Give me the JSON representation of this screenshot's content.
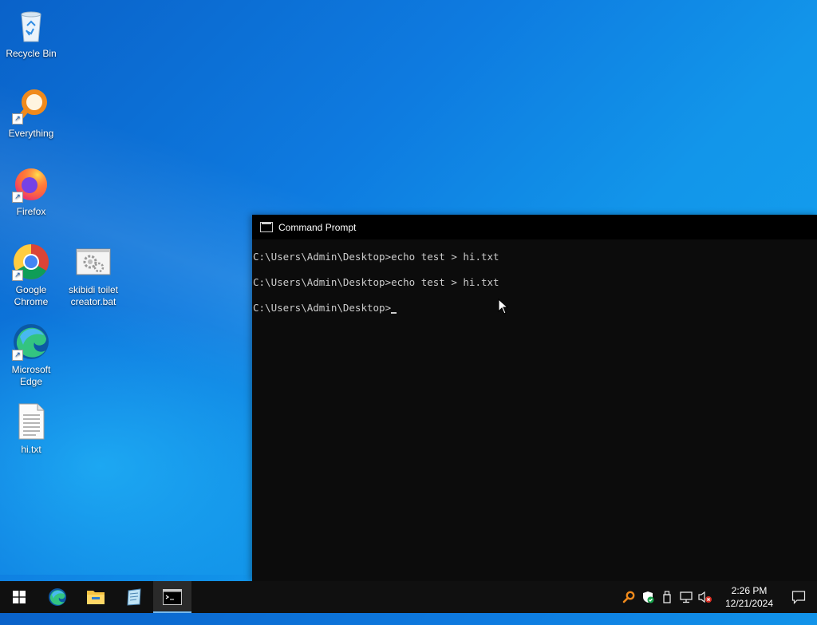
{
  "desktop": {
    "icons": [
      {
        "label": "Recycle Bin"
      },
      {
        "label": "Everything"
      },
      {
        "label": "Firefox"
      },
      {
        "label": "Google Chrome"
      },
      {
        "label": "skibidi toilet creator.bat"
      },
      {
        "label": "Microsoft Edge"
      },
      {
        "label": "hi.txt"
      }
    ]
  },
  "cmd": {
    "title": "Command Prompt",
    "lines": [
      "C:\\Users\\Admin\\Desktop>echo test > hi.txt",
      "C:\\Users\\Admin\\Desktop>echo test > hi.txt",
      "C:\\Users\\Admin\\Desktop>"
    ]
  },
  "taskbar": {
    "pinned": [
      "start-icon",
      "edge-icon",
      "file-explorer-icon",
      "notepad-icon",
      "command-prompt-icon"
    ],
    "active": "command-prompt-icon",
    "tray_icons": [
      "everything-search-icon",
      "windows-security-icon",
      "usb-drive-icon",
      "network-icon",
      "volume-muted-icon"
    ],
    "clock_time": "2:26 PM",
    "clock_date": "12/21/2024"
  },
  "colors": {
    "accent": "#76b9ed",
    "taskbar": "#101010",
    "console_bg": "#0c0c0c",
    "console_text": "#cccccc"
  }
}
